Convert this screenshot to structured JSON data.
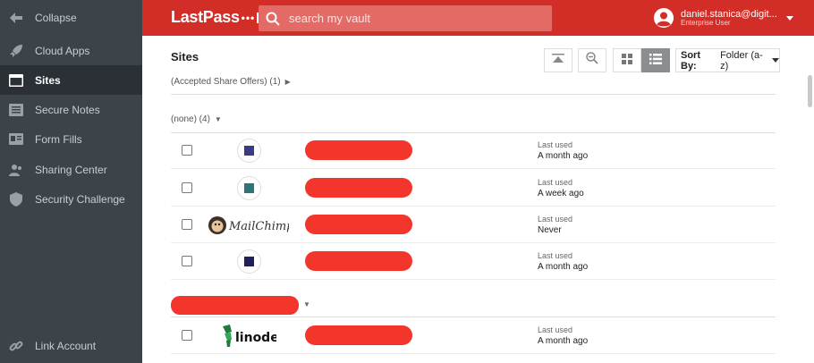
{
  "sidebar": {
    "items": [
      {
        "label": "Collapse",
        "icon": "arrow-left-icon",
        "active": false
      },
      {
        "label": "Cloud Apps",
        "icon": "rocket-icon",
        "active": false
      },
      {
        "label": "Sites",
        "icon": "browser-window-icon",
        "active": true
      },
      {
        "label": "Secure Notes",
        "icon": "notes-icon",
        "active": false
      },
      {
        "label": "Form Fills",
        "icon": "id-card-icon",
        "active": false
      },
      {
        "label": "Sharing Center",
        "icon": "share-users-icon",
        "active": false
      },
      {
        "label": "Security Challenge",
        "icon": "shield-icon",
        "active": false
      }
    ],
    "bottom_item": {
      "label": "Link Account",
      "icon": "link-icon"
    }
  },
  "header": {
    "logo_text": "LastPass",
    "logo_dots": "•••",
    "search_placeholder": "search my vault",
    "user_email": "daniel.stanica@digit...",
    "user_role": "Enterprise User"
  },
  "main": {
    "title": "Sites",
    "sort_label": "Sort By:",
    "sort_value": "Folder (a-z)",
    "accepted_shares": "(Accepted Share Offers) (1)",
    "group_none": "(none) (4)",
    "rows": [
      {
        "icon_color": "#3b3a84",
        "last_used_label": "Last used",
        "last_used": "A month ago"
      },
      {
        "icon_color": "#2f7478",
        "last_used_label": "Last used",
        "last_used": "A week ago"
      },
      {
        "logo": "MailChimp",
        "last_used_label": "Last used",
        "last_used": "Never"
      },
      {
        "icon_color": "#1f1f5c",
        "last_used_label": "Last used",
        "last_used": "A month ago"
      }
    ],
    "group2_rows": [
      {
        "logo": "linode",
        "last_used_label": "Last used",
        "last_used": "A month ago"
      }
    ]
  },
  "colors": {
    "brand_red": "#d32d27",
    "sidebar_bg": "#3d4449",
    "redaction": "#f4352b"
  }
}
